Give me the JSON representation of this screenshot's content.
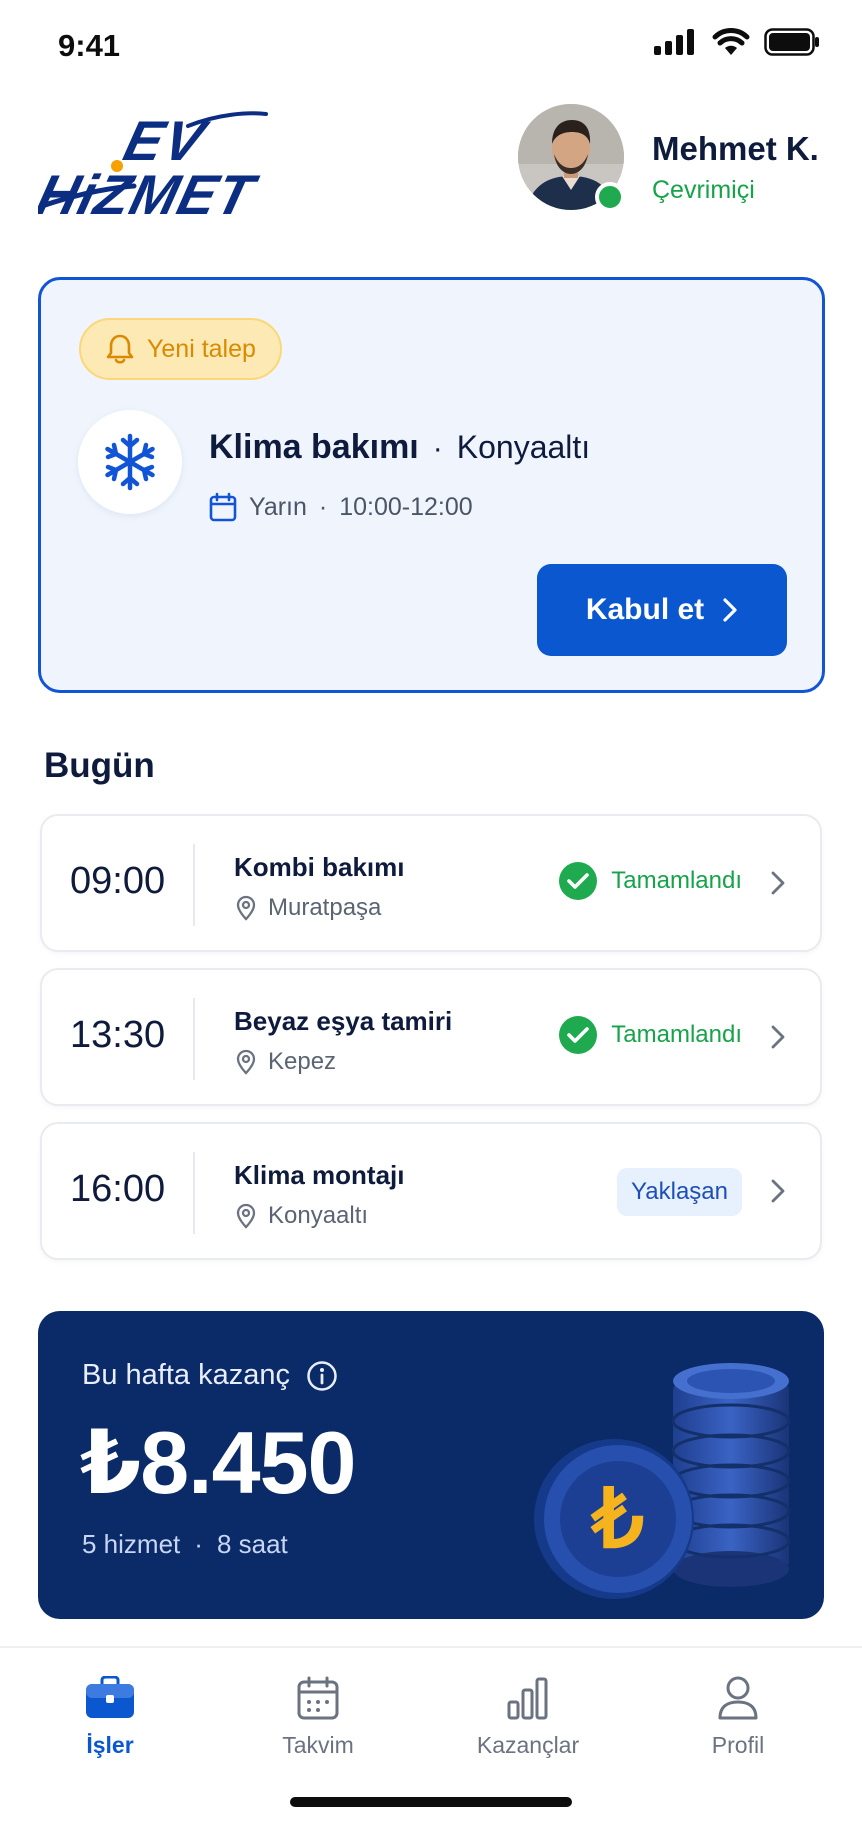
{
  "status_bar": {
    "time": "9:41"
  },
  "header": {
    "brand_line1": "EV",
    "brand_line2": "HiZMET",
    "user_name": "Mehmet K.",
    "user_status": "Çevrimiçi"
  },
  "request": {
    "badge": "Yeni talep",
    "service": "Klima bakımı",
    "separator": "·",
    "location": "Konyaaltı",
    "day": "Yarın",
    "dot": "·",
    "time": "10:00-12:00",
    "accept_label": "Kabul et"
  },
  "today": {
    "title": "Bugün",
    "jobs": [
      {
        "time": "09:00",
        "title": "Kombi bakımı",
        "location": "Muratpaşa",
        "status": "Tamamlandı"
      },
      {
        "time": "13:30",
        "title": "Beyaz eşya tamiri",
        "location": "Kepez",
        "status": "Tamamlandı"
      },
      {
        "time": "16:00",
        "title": "Klima montajı",
        "location": "Konyaaltı",
        "status": "Yaklaşan"
      }
    ]
  },
  "earnings": {
    "label": "Bu hafta kazanç",
    "amount": "₺8.450",
    "services": "5 hizmet",
    "dot": "·",
    "hours": "8 saat",
    "coin_symbol": "₺"
  },
  "nav": {
    "items": [
      {
        "label": "İşler",
        "icon": "briefcase-icon",
        "active": true
      },
      {
        "label": "Takvim",
        "icon": "calendar-icon",
        "active": false
      },
      {
        "label": "Kazançlar",
        "icon": "bar-chart-icon",
        "active": false
      },
      {
        "label": "Profil",
        "icon": "person-icon",
        "active": false
      }
    ]
  },
  "colors": {
    "primary": "#0b57d0",
    "navy": "#0a2a68",
    "success": "#16a34a",
    "warning": "#d98a00",
    "online": "#1faa4f"
  }
}
